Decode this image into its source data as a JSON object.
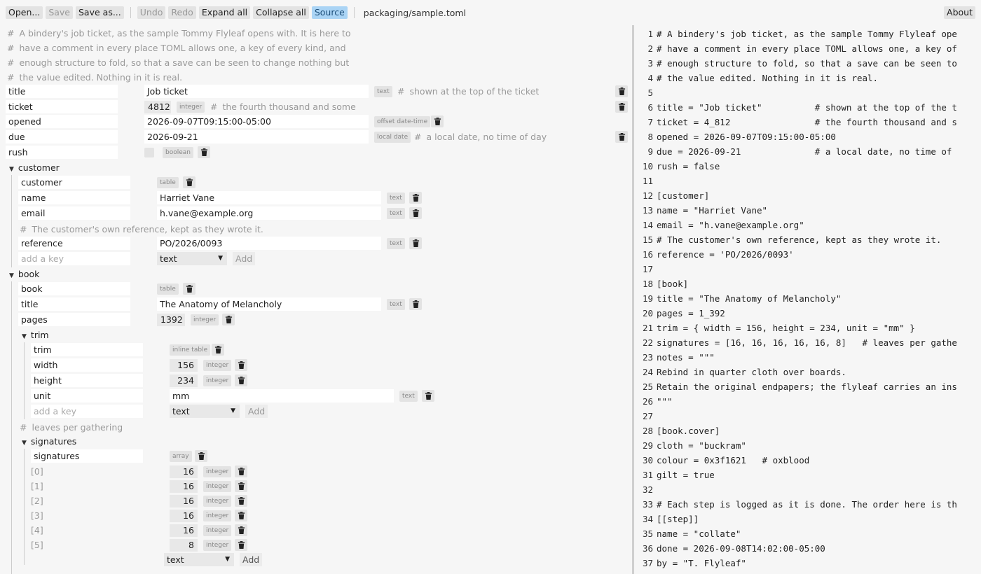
{
  "toolbar": {
    "open": "Open...",
    "save": "Save",
    "save_as": "Save as...",
    "undo": "Undo",
    "redo": "Redo",
    "expand_all": "Expand all",
    "collapse_all": "Collapse all",
    "source": "Source",
    "path": "packaging/sample.toml",
    "about": "About"
  },
  "tree": {
    "header_comments": [
      "A bindery's job ticket, as the sample Tommy Flyleaf opens with. It is here to",
      "have a comment in every place TOML allows one, a key of every kind, and",
      "enough structure to fold, so that a save can be seen to change nothing but",
      "the value edited. Nothing in it is real."
    ],
    "hash": "#",
    "top": {
      "title": {
        "key": "title",
        "value": "Job ticket",
        "tag": "text",
        "comment": "shown at the top of the ticket"
      },
      "ticket": {
        "key": "ticket",
        "value": "4812",
        "tag": "integer",
        "comment": "the fourth thousand and some"
      },
      "opened": {
        "key": "opened",
        "value": "2026-09-07T09:15:00-05:00",
        "tag": "offset date-time"
      },
      "due": {
        "key": "due",
        "value": "2026-09-21",
        "tag": "local date",
        "comment": "a local date, no time of day"
      },
      "rush": {
        "key": "rush",
        "tag": "boolean"
      }
    },
    "customer": {
      "section": "customer",
      "self": {
        "key": "customer",
        "tag": "table"
      },
      "name": {
        "key": "name",
        "value": "Harriet Vane",
        "tag": "text"
      },
      "email": {
        "key": "email",
        "value": "h.vane@example.org",
        "tag": "text"
      },
      "comment": "The customer's own reference, kept as they wrote it.",
      "reference": {
        "key": "reference",
        "value": "PO/2026/0093",
        "tag": "text"
      },
      "add_placeholder": "add a key",
      "add_type": "text",
      "add_button": "Add"
    },
    "book": {
      "section": "book",
      "self": {
        "key": "book",
        "tag": "table"
      },
      "title": {
        "key": "title",
        "value": "The Anatomy of Melancholy",
        "tag": "text"
      },
      "pages": {
        "key": "pages",
        "value": "1392",
        "tag": "integer"
      },
      "trim": {
        "section": "trim",
        "self": {
          "key": "trim",
          "tag": "inline table"
        },
        "width": {
          "key": "width",
          "value": "156",
          "tag": "integer"
        },
        "height": {
          "key": "height",
          "value": "234",
          "tag": "integer"
        },
        "unit": {
          "key": "unit",
          "value": "mm",
          "tag": "text"
        },
        "add_placeholder": "add a key",
        "add_type": "text",
        "add_button": "Add"
      },
      "signatures_comment": "leaves per gathering",
      "signatures": {
        "section": "signatures",
        "self": {
          "key": "signatures",
          "tag": "array"
        },
        "items": [
          {
            "index": "[0]",
            "value": "16",
            "tag": "integer"
          },
          {
            "index": "[1]",
            "value": "16",
            "tag": "integer"
          },
          {
            "index": "[2]",
            "value": "16",
            "tag": "integer"
          },
          {
            "index": "[3]",
            "value": "16",
            "tag": "integer"
          },
          {
            "index": "[4]",
            "value": "16",
            "tag": "integer"
          },
          {
            "index": "[5]",
            "value": "8",
            "tag": "integer"
          }
        ],
        "add_type": "text",
        "add_button": "Add"
      }
    }
  },
  "source": {
    "lines": [
      "# A bindery's job ticket, as the sample Tommy Flyleaf ope",
      "# have a comment in every place TOML allows one, a key of",
      "# enough structure to fold, so that a save can be seen to",
      "# the value edited. Nothing in it is real.",
      "",
      "title = \"Job ticket\"          # shown at the top of the t",
      "ticket = 4_812                # the fourth thousand and s",
      "opened = 2026-09-07T09:15:00-05:00",
      "due = 2026-09-21              # a local date, no time of",
      "rush = false",
      "",
      "[customer]",
      "name = \"Harriet Vane\"",
      "email = \"h.vane@example.org\"",
      "# The customer's own reference, kept as they wrote it.",
      "reference = 'PO/2026/0093'",
      "",
      "[book]",
      "title = \"The Anatomy of Melancholy\"",
      "pages = 1_392",
      "trim = { width = 156, height = 234, unit = \"mm\" }",
      "signatures = [16, 16, 16, 16, 16, 8]   # leaves per gathe",
      "notes = \"\"\"",
      "Rebind in quarter cloth over boards.",
      "Retain the original endpapers; the flyleaf carries an ins",
      "\"\"\"",
      "",
      "[book.cover]",
      "cloth = \"buckram\"",
      "colour = 0x3f1621   # oxblood",
      "gilt = true",
      "",
      "# Each step is logged as it is done. The order here is th",
      "[[step]]",
      "name = \"collate\"",
      "done = 2026-09-08T14:02:00-05:00",
      "by = \"T. Flyleaf\""
    ]
  },
  "icons": {
    "trash": "trash-icon",
    "expand": "triangle-down-icon",
    "select_caret": "caret-down-icon"
  },
  "colors": {
    "background": "#f6f6f6",
    "field": "#ffffff",
    "source_active": "#aad4f5",
    "comment": "#999999"
  }
}
